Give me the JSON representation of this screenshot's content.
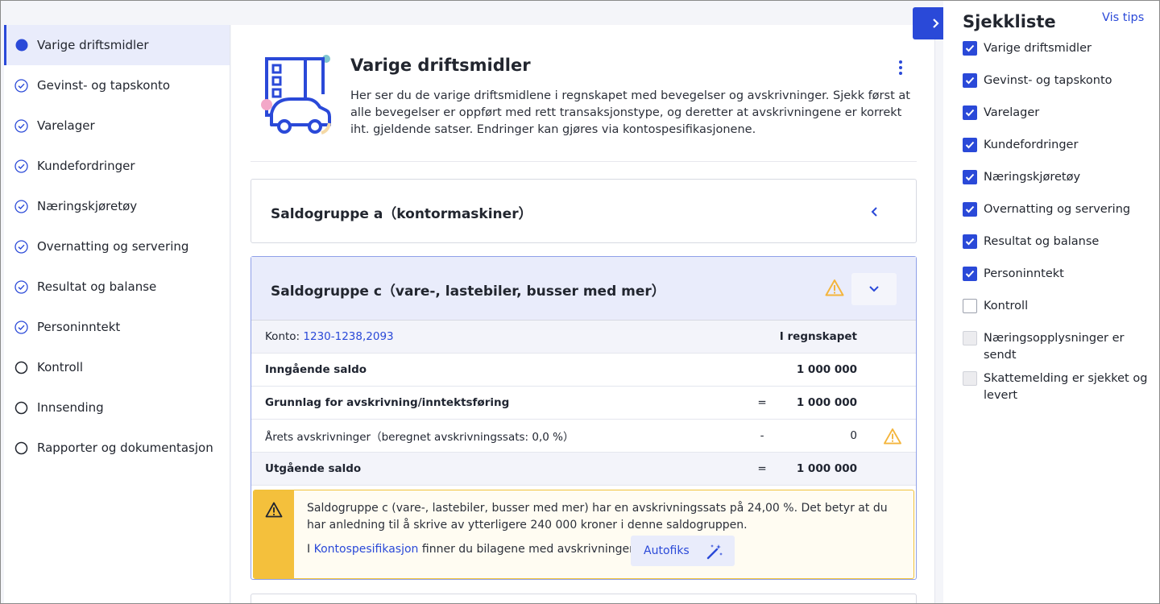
{
  "sidebar": {
    "items": [
      {
        "label": "Varige driftsmidler",
        "state": "active"
      },
      {
        "label": "Gevinst- og tapskonto",
        "state": "done"
      },
      {
        "label": "Varelager",
        "state": "done"
      },
      {
        "label": "Kundefordringer",
        "state": "done"
      },
      {
        "label": "Næringskjøretøy",
        "state": "done"
      },
      {
        "label": "Overnatting og servering",
        "state": "done"
      },
      {
        "label": "Resultat og balanse",
        "state": "done"
      },
      {
        "label": "Personinntekt",
        "state": "done"
      },
      {
        "label": "Kontroll",
        "state": "todo"
      },
      {
        "label": "Innsending",
        "state": "todo"
      },
      {
        "label": "Rapporter og dokumentasjon",
        "state": "todo"
      }
    ]
  },
  "main": {
    "title": "Varige driftsmidler",
    "description": "Her ser du de varige driftsmidlene i regnskapet med bevegelser og avskrivninger. Sjekk først at alle bevegelser er oppført med rett transaksjonstype, og deretter at avskrivningene er korrekt iht. gjeldende satser. Endringer kan gjøres via kontospesifikasjonene.",
    "group_a": {
      "title": "Saldogruppe a（kontormaskiner）"
    },
    "group_c": {
      "title": "Saldogruppe c（vare-, lastebiler, busser med mer）",
      "konto_label": "Konto:",
      "konto_value": "1230-1238,2093",
      "column_header": "I regnskapet",
      "rows": [
        {
          "label": "Inngående saldo",
          "op": "",
          "value": "1 000 000"
        },
        {
          "label": "Grunnlag for avskrivning/inntektsføring",
          "op": "=",
          "value": "1 000 000"
        },
        {
          "label": "Årets avskrivninger（beregnet avskrivningssats: 0,0 %）",
          "op": "-",
          "value": "0"
        },
        {
          "label": "Utgående saldo",
          "op": "=",
          "value": "1 000 000"
        }
      ],
      "alert": {
        "text": "Saldogruppe c (vare-, lastebiler, busser med mer) har en avskrivningssats på 24,00 %. Det betyr at du har anledning til å skrive av ytterligere 240 000 kroner i denne saldogruppen.",
        "line3_prefix": "I",
        "line3_link": "Kontospesifikasjon",
        "line3_suffix": "finner du bilagene med avskrivninger.",
        "button": "Autofiks"
      }
    }
  },
  "checklist": {
    "title": "Sjekkliste",
    "tips_link": "Vis tips",
    "items": [
      {
        "label": "Varige driftsmidler",
        "checked": true
      },
      {
        "label": "Gevinst- og tapskonto",
        "checked": true
      },
      {
        "label": "Varelager",
        "checked": true
      },
      {
        "label": "Kundefordringer",
        "checked": true
      },
      {
        "label": "Næringskjøretøy",
        "checked": true
      },
      {
        "label": "Overnatting og servering",
        "checked": true
      },
      {
        "label": "Resultat og balanse",
        "checked": true
      },
      {
        "label": "Personinntekt",
        "checked": true
      },
      {
        "label": "Kontroll",
        "checked": false
      },
      {
        "label": "Næringsopplysninger er sendt",
        "checked": false
      },
      {
        "label": "Skattemelding er sjekket og levert",
        "checked": false
      }
    ]
  },
  "colors": {
    "accent": "#2a49d8",
    "warning": "#f4c03c",
    "active_bg": "#e9ecfb"
  }
}
